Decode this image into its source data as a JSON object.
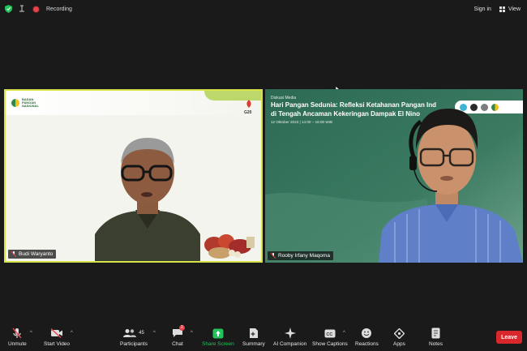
{
  "topbar": {
    "recording_label": "Recording",
    "sign_in": "Sign in",
    "view": "View"
  },
  "participants": {
    "left": {
      "name": "Budi Waryanto"
    },
    "right": {
      "name": "Rooby Irfany Maqoma",
      "slide_kicker": "Diskusi Media",
      "slide_title_line1": "Hari Pangan Sedunia: Refleksi Ketahanan Pangan Ind",
      "slide_title_line2": "di Tengah Ancaman Kekeringan Dampak El Nino",
      "slide_date": "12 Oktober 2023 | 14:00 – 16:00 WIB"
    }
  },
  "left_banner": {
    "logo_text_1": "BADAN",
    "logo_text_2": "PANGAN",
    "logo_text_3": "NASIONAL",
    "g20": "G20"
  },
  "toolbar": {
    "unmute": "Unmute",
    "start_video": "Start Video",
    "participants": "Participants",
    "participants_count": "45",
    "chat": "Chat",
    "chat_badge": "2",
    "share_screen": "Share Screen",
    "summary": "Summary",
    "ai_companion": "AI Companion",
    "show_captions": "Show Captions",
    "reactions": "Reactions",
    "apps": "Apps",
    "notes": "Notes",
    "leave": "Leave"
  },
  "colors": {
    "accent_green": "#23c35b",
    "leave_red": "#d8272d",
    "active_speaker": "#d6e34a"
  }
}
